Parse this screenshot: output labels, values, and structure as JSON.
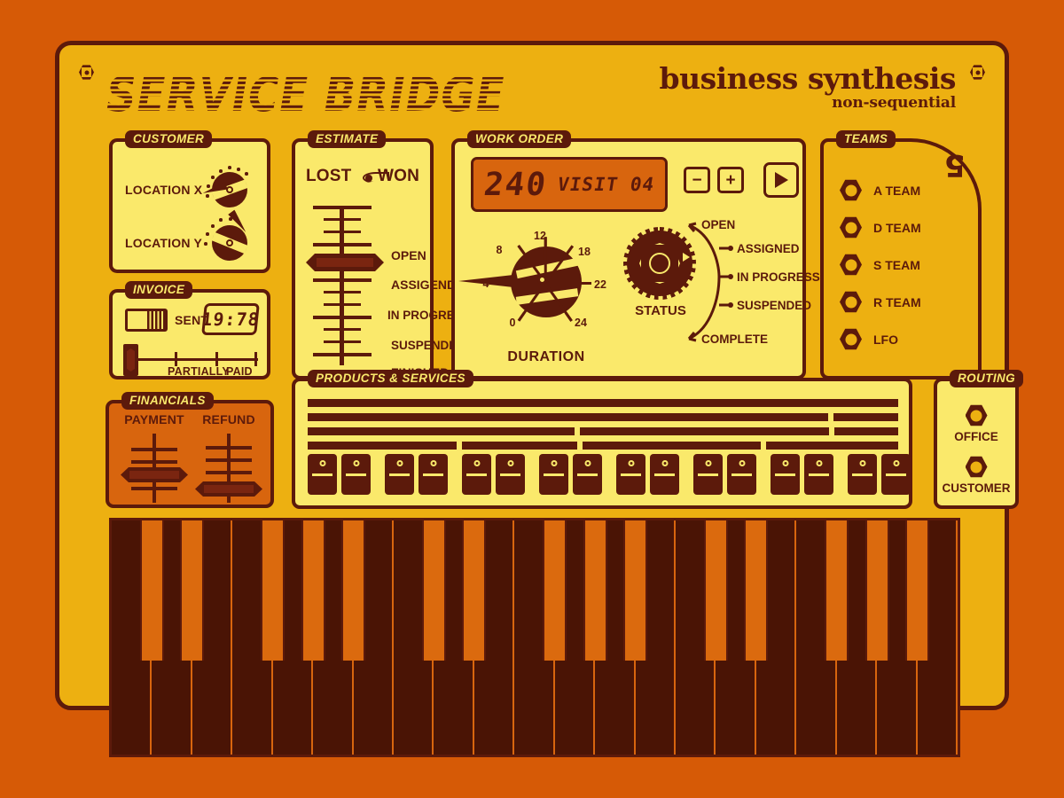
{
  "header": {
    "title": "SERVICE BRIDGE",
    "subtitle_main": "business synthesis",
    "subtitle_small": "non-sequential"
  },
  "customer": {
    "label": "CUSTOMER",
    "rows": [
      {
        "label": "LOCATION X",
        "icon": "rotary-knob-icon"
      },
      {
        "label": "LOCATION Y",
        "icon": "rotary-knob-icon"
      }
    ]
  },
  "invoice": {
    "label": "INVOICE",
    "toggle_label": "SENT",
    "display_value": "19:78",
    "slider_caption_partially": "PARTIALLY",
    "slider_caption_paid": "PAID"
  },
  "financials": {
    "label": "FINANCIALS",
    "faders": [
      {
        "label": "PAYMENT"
      },
      {
        "label": "REFUND"
      }
    ]
  },
  "estimate": {
    "label": "ESTIMATE",
    "lost": "LOST",
    "won": "WON",
    "eye_icon": "eye-icon",
    "steps": [
      "OPEN",
      "ASSIGEND",
      "IN PROGRESS",
      "SUSPENDED",
      "FINISHED"
    ],
    "selected_step": "ASSIGEND"
  },
  "workorder": {
    "label": "WORK ORDER",
    "lcd_number": "240",
    "lcd_text": "VISIT 04",
    "minus_label": "−",
    "plus_label": "+",
    "play_icon": "play-icon",
    "duration": {
      "caption": "DURATION",
      "ticks": [
        "0",
        "4",
        "8",
        "12",
        "18",
        "22",
        "24"
      ],
      "pointer_value": "4"
    },
    "status": {
      "caption": "STATUS",
      "options": [
        "OPEN",
        "ASSIGNED",
        "IN PROGRESS",
        "SUSPENDED",
        "COMPLETE"
      ]
    }
  },
  "teams": {
    "label": "TEAMS",
    "logo": "5",
    "items": [
      "A TEAM",
      "D TEAM",
      "S TEAM",
      "R TEAM",
      "LFO"
    ]
  },
  "products": {
    "label": "PRODUCTS & SERVICES",
    "bar_rows": [
      [
        100
      ],
      [
        89,
        11
      ],
      [
        46,
        43,
        11
      ],
      [
        26,
        20,
        31,
        23
      ]
    ],
    "switch_count": 16
  },
  "routing": {
    "label": "ROUTING",
    "items": [
      "OFFICE",
      "CUSTOMER"
    ]
  },
  "keyboard": {
    "white_key_count": 21,
    "octave_pattern": "CDEFGAB"
  },
  "colors": {
    "outer_background": "#D65A06",
    "body_gold": "#EDB011",
    "panel_yellow": "#FAE96B",
    "panel_orange": "#D8650E",
    "ink_brown": "#5C1A0B",
    "key_dark": "#4A1405",
    "key_orange": "#DB6A0E"
  }
}
